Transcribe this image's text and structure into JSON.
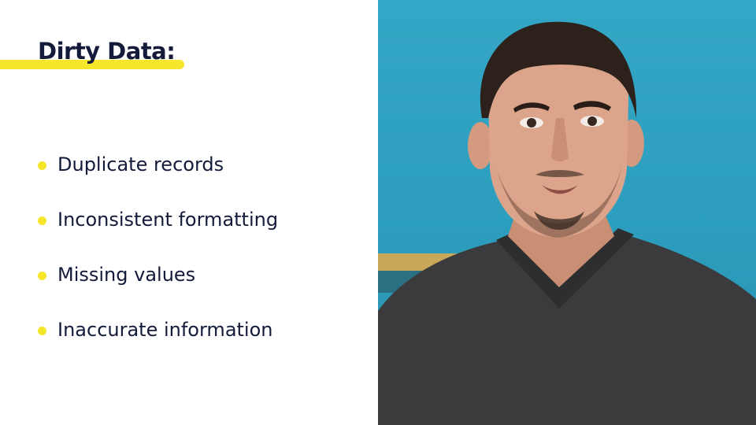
{
  "slide": {
    "title": "Dirty Data:",
    "bullets": [
      "Duplicate records",
      "Inconsistent formatting",
      "Missing values",
      "Inaccurate information"
    ]
  },
  "colors": {
    "accent_yellow": "#f5e62b",
    "text_navy": "#141a3a",
    "backdrop_teal": "#2fa2c2",
    "shirt_charcoal": "#3b3b3d"
  },
  "video": {
    "subject": "presenter-person"
  }
}
